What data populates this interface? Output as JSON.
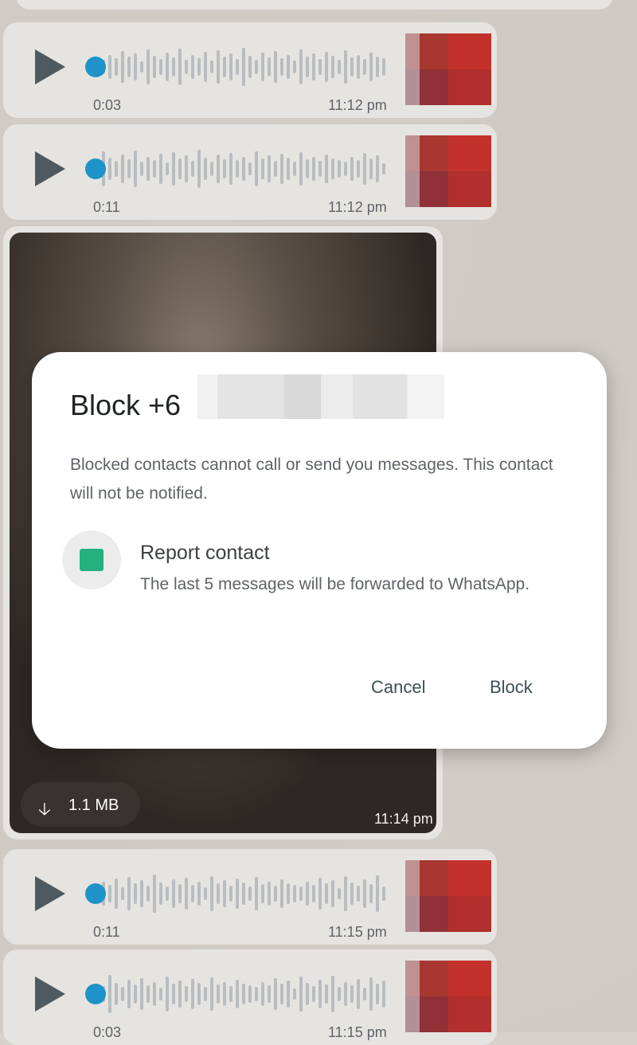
{
  "messages": [
    {
      "type": "voice",
      "duration": "0:03",
      "time": "11:12 pm"
    },
    {
      "type": "voice",
      "duration": "0:11",
      "time": "11:12 pm"
    },
    {
      "type": "image",
      "size": "1.1 MB",
      "time": "11:14 pm"
    },
    {
      "type": "voice",
      "duration": "0:11",
      "time": "11:15 pm"
    },
    {
      "type": "voice",
      "duration": "0:03",
      "time": "11:15 pm"
    }
  ],
  "dialog": {
    "title": "Block +6",
    "description": "Blocked contacts cannot call or send you messages. This contact will not be notified.",
    "report": {
      "title": "Report contact",
      "subtitle": "The last 5 messages will be forwarded to WhatsApp."
    },
    "cancel_label": "Cancel",
    "block_label": "Block"
  },
  "icons": {
    "play": "play-icon",
    "download": "download-icon",
    "checkbox": "checkbox-icon"
  },
  "colors": {
    "accent_blue": "#1f93c9",
    "checkbox_green": "#25b17f"
  }
}
